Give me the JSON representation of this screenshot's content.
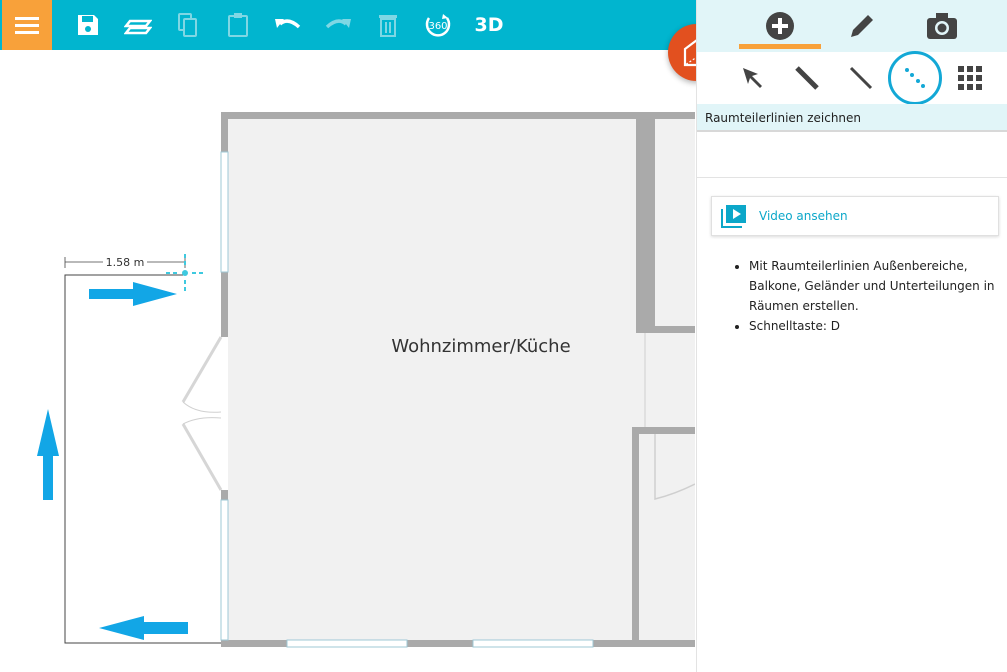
{
  "toolbar": {
    "menu_icon": "hamburger-icon",
    "items": [
      "save-icon",
      "layers-icon",
      "copy-icon",
      "paste-icon",
      "undo-icon",
      "redo-icon",
      "delete-icon",
      "view-360-icon"
    ],
    "label_360": "360",
    "label_3d": "3D",
    "accent": "#01b5cf",
    "menu_color": "#f8a13a"
  },
  "fab": {
    "icon": "3d-house-icon",
    "color": "#e2501f"
  },
  "panel": {
    "tabs": [
      "add-icon",
      "edit-pencil-icon",
      "camera-icon"
    ],
    "tools": [
      "select-arrow-icon",
      "wall-line-icon",
      "thin-line-icon",
      "divider-line-icon",
      "grid-icon"
    ],
    "title": "Raumteilerlinien zeichnen",
    "video_label": "Video ansehen",
    "help": [
      "Mit Raumteilerlinien Außenbereiche, Balkone, Geländer und Unterteilungen in Räumen erstellen.",
      "Schnelltaste: D"
    ]
  },
  "plan": {
    "room_label": "Wohnzimmer/Küche",
    "dimension_label": "1.58 m"
  }
}
